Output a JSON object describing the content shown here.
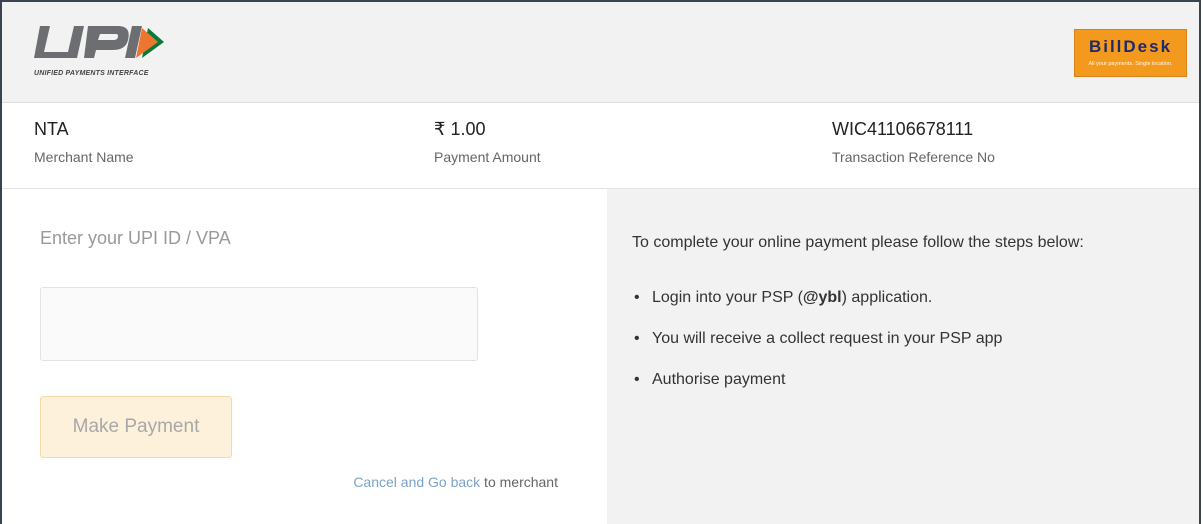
{
  "header": {
    "logo_caption": "UNIFIED PAYMENTS INTERFACE",
    "billdesk_name": "BillDesk",
    "billdesk_tagline": "All your payments. Single location."
  },
  "merchant": {
    "name_value": "NTA",
    "name_label": "Merchant Name",
    "amount_value": "₹ 1.00",
    "amount_label": "Payment Amount",
    "ref_value": "WIC41106678111",
    "ref_label": "Transaction Reference No"
  },
  "form": {
    "vpa_label": "Enter your UPI ID / VPA",
    "vpa_value": "",
    "pay_button": "Make Payment",
    "cancel_link": "Cancel and Go back",
    "cancel_suffix": " to merchant"
  },
  "instructions": {
    "intro": "To complete your online payment please follow the steps below:",
    "step1_prefix": "Login into your PSP (",
    "step1_psp": "@ybl",
    "step1_suffix": ") application.",
    "step2": "You will receive a collect request in your PSP app",
    "step3": "Authorise payment"
  },
  "colors": {
    "header_bg": "#f2f2f2",
    "billdesk_orange": "#f39a1e",
    "button_bg": "#fdf1dc",
    "link": "#7ba3c7",
    "right_pane_bg": "#f2f2f2"
  }
}
